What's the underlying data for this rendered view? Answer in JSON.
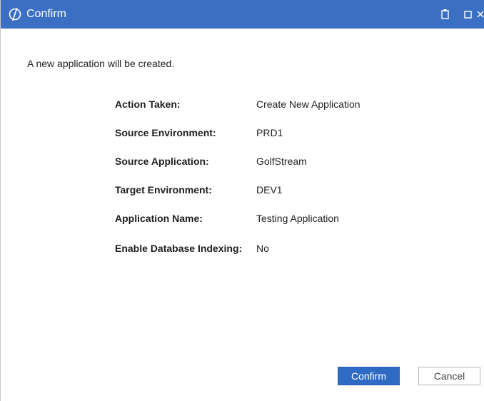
{
  "window": {
    "title": "Confirm",
    "titlebar_color": "#3a6fc4",
    "logo_icon": "app-logo-icon",
    "pin_icon": "clipboard-icon",
    "maximize_icon": "maximize-icon",
    "close_icon": "close-icon"
  },
  "message": "A new application will be created.",
  "details": [
    {
      "label": "Action Taken:",
      "value": "Create New Application"
    },
    {
      "label": "Source Environment:",
      "value": "PRD1"
    },
    {
      "label": "Source Application:",
      "value": "GolfStream"
    },
    {
      "label": "Target Environment:",
      "value": "DEV1"
    },
    {
      "label": "Application Name:",
      "value": "Testing Application"
    },
    {
      "label": "Enable Database Indexing:",
      "value": "No"
    }
  ],
  "buttons": {
    "confirm_label": "Confirm",
    "cancel_label": "Cancel",
    "primary_color": "#2f6bc5"
  }
}
